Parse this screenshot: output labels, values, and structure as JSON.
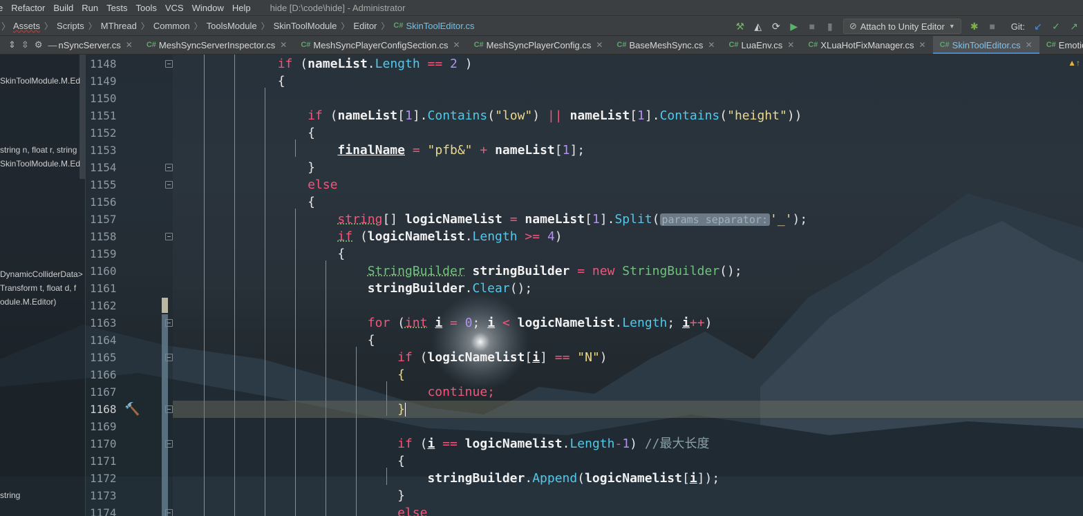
{
  "menu": {
    "items": [
      "e",
      "Refactor",
      "Build",
      "Run",
      "Tests",
      "Tools",
      "VCS",
      "Window",
      "Help"
    ],
    "window_title": "hide [D:\\code\\hide] - Administrator"
  },
  "breadcrumb": {
    "items": [
      "Assets",
      "Scripts",
      "MThread",
      "Common",
      "ToolsModule",
      "SkinToolModule",
      "Editor"
    ],
    "file": "SkinToolEditor.cs",
    "cs_tag": "C#"
  },
  "toolbar": {
    "attach_label": "Attach to Unity Editor",
    "git_label": "Git:"
  },
  "tabs": [
    {
      "label": "nSyncServer.cs",
      "active": false,
      "has_icon": false
    },
    {
      "label": "MeshSyncServerInspector.cs",
      "active": false,
      "has_icon": true
    },
    {
      "label": "MeshSyncPlayerConfigSection.cs",
      "active": false,
      "has_icon": true
    },
    {
      "label": "MeshSyncPlayerConfig.cs",
      "active": false,
      "has_icon": true
    },
    {
      "label": "BaseMeshSync.cs",
      "active": false,
      "has_icon": true
    },
    {
      "label": "LuaEnv.cs",
      "active": false,
      "has_icon": true
    },
    {
      "label": "XLuaHotFixManager.cs",
      "active": false,
      "has_icon": true
    },
    {
      "label": "SkinToolEditor.cs",
      "active": true,
      "has_icon": true
    },
    {
      "label": "EmotionI",
      "active": false,
      "has_icon": true
    }
  ],
  "left_panel": [
    "SkinToolModule.M.Ed",
    "string n, float r, string",
    "SkinToolModule.M.Ed",
    "DynamicColliderData>",
    "Transform t, float d, f",
    "odule.M.Editor)",
    "string"
  ],
  "line_numbers": [
    "1148",
    "1149",
    "1150",
    "1151",
    "1152",
    "1153",
    "1154",
    "1155",
    "1156",
    "1157",
    "1158",
    "1159",
    "1160",
    "1161",
    "1162",
    "1163",
    "1164",
    "1165",
    "1166",
    "1167",
    "1168",
    "1169",
    "1170",
    "1171",
    "1172",
    "1173",
    "1174"
  ],
  "code": {
    "param_hint": "params separator:",
    "comment": "//最大长度",
    "strings": {
      "low": "\"low\"",
      "height": "\"height\"",
      "pfb": "\"pfb&\"",
      "underscore": "'_'",
      "N": "\"N\""
    }
  },
  "current_line": "1168"
}
